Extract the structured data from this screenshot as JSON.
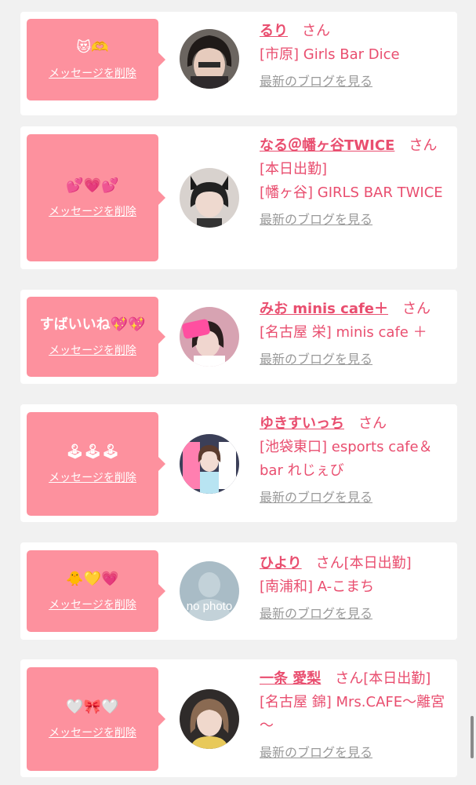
{
  "delete_label": "メッセージを削除",
  "blog_label": "最新のブログを見る",
  "san": "さん",
  "colors": {
    "bubble": "#fd919e",
    "name": "#e94e6f",
    "blog_link": "#9a9a9a",
    "background": "#f1f1f1"
  },
  "items": [
    {
      "message": "😻🫶",
      "name": "るり",
      "lines": [
        "[市原] Girls Bar Dice"
      ],
      "avatar": "girl-face-photo"
    },
    {
      "message": "💕💗💕",
      "name": "なる＠幡ヶ谷TWICE",
      "lines": [
        "[本日出勤]",
        "[幡ヶ谷] GIRLS BAR TWICE"
      ],
      "avatar": "cat-ears-girl-photo"
    },
    {
      "message": "すばいいね💖💖",
      "name": "みお minis cafe＋",
      "lines": [
        "[名古屋 栄] minis cafe ＋"
      ],
      "avatar": "pink-sign-girl-photo"
    },
    {
      "message": "🕹🕹🕹",
      "name": "ゆきすいっち",
      "lines": [
        "[池袋東口] esports cafe＆bar れじぇび"
      ],
      "avatar": "arcade-girl-photo"
    },
    {
      "message": "🐥💛💗",
      "name": "ひより",
      "tag": "[本日出勤]",
      "lines": [
        "[南浦和] A-こまち"
      ],
      "avatar": "no-photo-placeholder",
      "no_photo_text": "no photo"
    },
    {
      "message": "🤍🎀🤍",
      "name": "一条 愛梨",
      "tag": "[本日出勤]",
      "lines": [
        "[名古屋 錦] Mrs.CAFE～離宮～"
      ],
      "avatar": "brown-hair-girl-photo"
    }
  ]
}
